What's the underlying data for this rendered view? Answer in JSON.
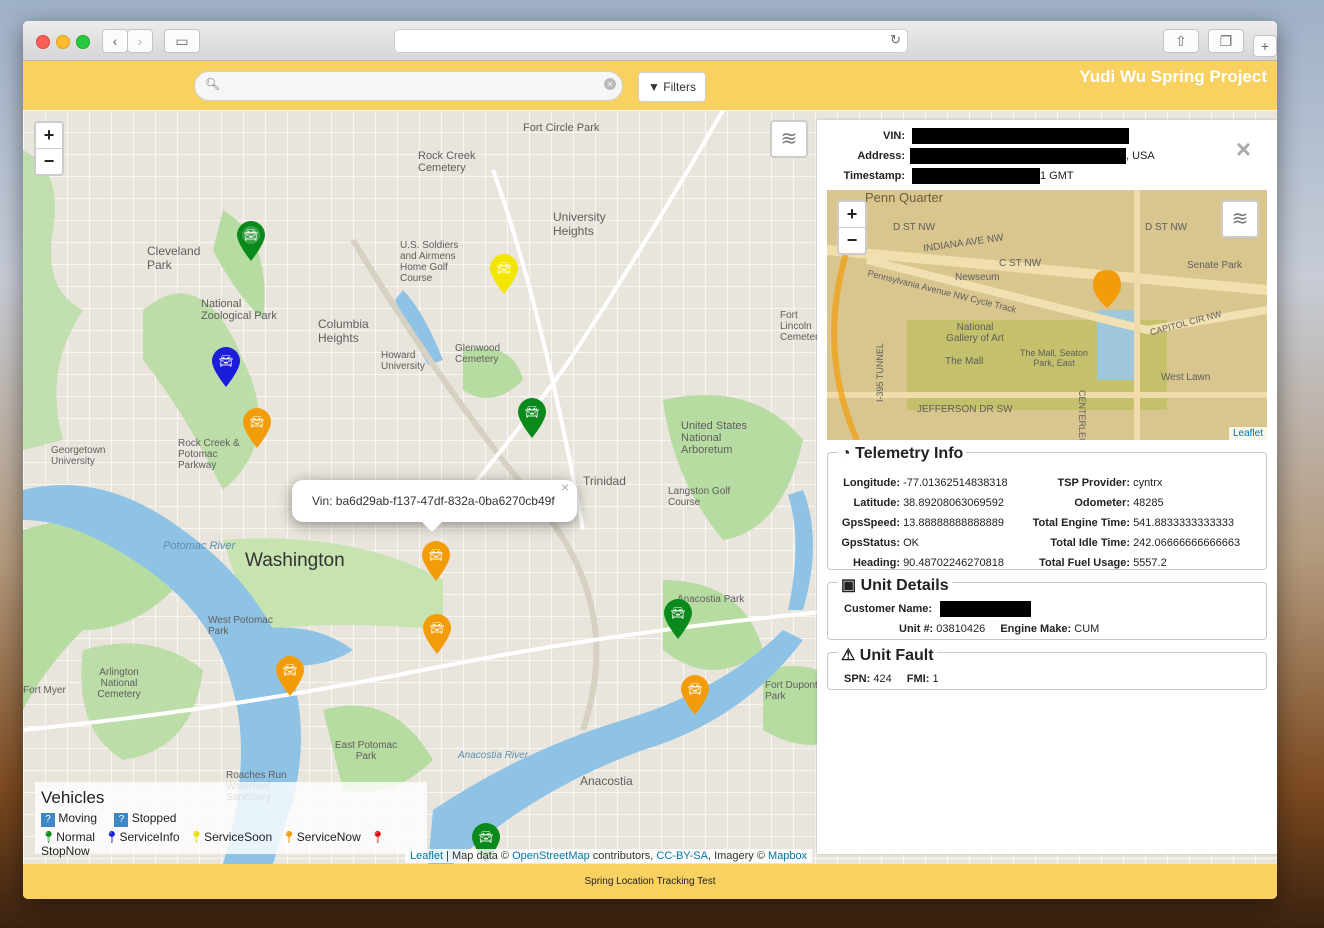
{
  "window": {
    "brand": "Yudi Wu Spring Project",
    "footer": "Spring Location Tracking Test"
  },
  "toolbar": {
    "filters_label": "Filters",
    "search_placeholder": ""
  },
  "map": {
    "labels": [
      {
        "t": "Fort Circle Park"
      },
      {
        "t": "Rock Creek Cemetery"
      },
      {
        "t": "University Heights"
      },
      {
        "t": "Cleveland Park"
      },
      {
        "t": "U.S. Soldiers and Airmens Home Golf Course"
      },
      {
        "t": "National Zoological Park"
      },
      {
        "t": "Columbia Heights"
      },
      {
        "t": "Howard University"
      },
      {
        "t": "Glenwood Cemetery"
      },
      {
        "t": "Rock Creek & Potomac Parkway"
      },
      {
        "t": "Georgetown University"
      },
      {
        "t": "United States National Arboretum"
      },
      {
        "t": "Trinidad"
      },
      {
        "t": "Langston Golf Course"
      },
      {
        "t": "Washington"
      },
      {
        "t": "West Potomac Park"
      },
      {
        "t": "Arlington National Cemetery"
      },
      {
        "t": "East Potomac Park"
      },
      {
        "t": "Anacostia"
      },
      {
        "t": "Fort Myer"
      },
      {
        "t": "Fort Dupont Park"
      },
      {
        "t": "Roaches Run Waterfowl Sanctuary"
      },
      {
        "t": "Anacostia Park"
      },
      {
        "t": "Fort Lincoln Cemetery"
      },
      {
        "t": "Potomac River"
      },
      {
        "t": "Anacostia River"
      }
    ],
    "popup_text": "Vin: ba6d29ab-f137-47df-832a-0ba6270cb49f",
    "attribution": {
      "leaflet": "Leaflet",
      "mid": " | Map data © ",
      "osm": "OpenStreetMap",
      "mid2": " contributors, ",
      "lic": "CC-BY-SA",
      "mid3": ", Imagery © ",
      "mapbox": "Mapbox"
    }
  },
  "legend": {
    "title": "Vehicles",
    "moving": "Moving",
    "stopped": "Stopped",
    "items": [
      "Normal",
      "ServiceInfo",
      "ServiceSoon",
      "ServiceNow",
      "StopNow"
    ],
    "colors": [
      "#0a8a1a",
      "#1c1cdb",
      "#e8e000",
      "#f29c0a",
      "#e01010"
    ]
  },
  "detail": {
    "vin_label": "VIN:",
    "address_label": "Address:",
    "address_suffix": ", USA",
    "timestamp_label": "Timestamp:",
    "timestamp_suffix": "1 GMT",
    "minimap_labels": [
      "Penn Quarter",
      "D ST NW",
      "INDIANA AVE NW",
      "D ST NW",
      "C ST NW",
      "Newseum",
      "Senate Park",
      "Pennsylvania Avenue NW Cycle Track",
      "National Gallery of Art",
      "The Mall",
      "The Mall, Seaton Park, East",
      "CAPITOL CIR NW",
      "West Lawn",
      "JEFFERSON DR SW",
      "CENTERLEG RD",
      "I-395 TUNNEL"
    ],
    "minimap_attrib": "Leaflet",
    "telemetry": {
      "title": "Telemetry Info",
      "left": [
        [
          "Longitude:",
          "-77.01362514838318"
        ],
        [
          "Latitude:",
          "38.89208063069592"
        ],
        [
          "GpsSpeed:",
          "13.88888888888889"
        ],
        [
          "GpsStatus:",
          "OK"
        ],
        [
          "Heading:",
          "90.48702246270818"
        ]
      ],
      "right": [
        [
          "TSP Provider:",
          "cyntrx"
        ],
        [
          "Odometer:",
          "48285"
        ],
        [
          "Total Engine Time:",
          "541.8833333333333"
        ],
        [
          "Total Idle Time:",
          "242.06666666666663"
        ],
        [
          "Total Fuel Usage:",
          "5557.2"
        ]
      ]
    },
    "unit": {
      "title": "Unit Details",
      "customer_label": "Customer Name:",
      "unit_label": "Unit #:",
      "unit_value": "03810426",
      "engine_label": "Engine Make:",
      "engine_value": "CUM"
    },
    "fault": {
      "title": "Unit Fault",
      "spn_label": "SPN:",
      "spn_value": "424",
      "fmi_label": "FMI:",
      "fmi_value": "1"
    }
  }
}
